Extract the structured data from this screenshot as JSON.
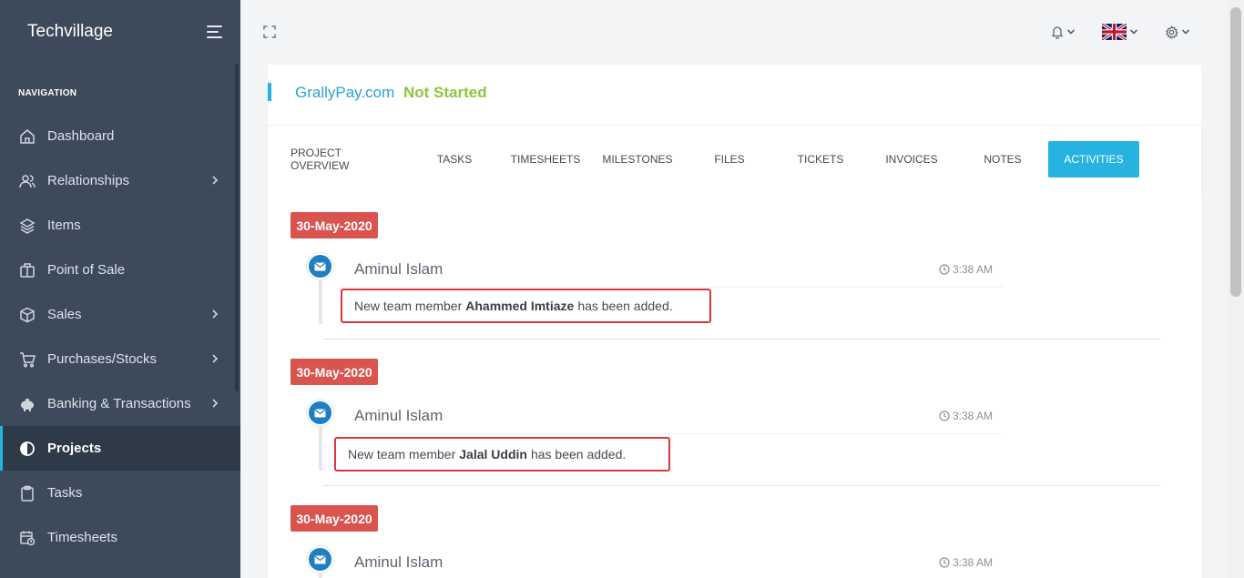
{
  "app": {
    "brand": "Techvillage"
  },
  "sidebar": {
    "heading": "NAVIGATION",
    "items": [
      {
        "label": "Dashboard",
        "icon": "home-icon",
        "has_children": false,
        "active": false
      },
      {
        "label": "Relationships",
        "icon": "users-icon",
        "has_children": true,
        "active": false
      },
      {
        "label": "Items",
        "icon": "layers-icon",
        "has_children": false,
        "active": false
      },
      {
        "label": "Point of Sale",
        "icon": "briefcase-icon",
        "has_children": false,
        "active": false
      },
      {
        "label": "Sales",
        "icon": "box-icon",
        "has_children": true,
        "active": false
      },
      {
        "label": "Purchases/Stocks",
        "icon": "cart-icon",
        "has_children": true,
        "active": false
      },
      {
        "label": "Banking & Transactions",
        "icon": "piggy-bank-icon",
        "has_children": true,
        "active": false
      },
      {
        "label": "Projects",
        "icon": "half-circle-icon",
        "has_children": false,
        "active": true
      },
      {
        "label": "Tasks",
        "icon": "clipboard-icon",
        "has_children": false,
        "active": false
      },
      {
        "label": "Timesheets",
        "icon": "calendar-clock-icon",
        "has_children": false,
        "active": false
      }
    ]
  },
  "topbar": {
    "expand_icon": "fullscreen-icon",
    "notifications_icon": "bell-icon",
    "language_icon": "uk-flag-icon",
    "settings_icon": "gear-icon"
  },
  "project": {
    "name": "GrallyPay.com",
    "status": "Not Started"
  },
  "tabs": [
    {
      "label": "PROJECT OVERVIEW",
      "active": false
    },
    {
      "label": "TASKS",
      "active": false
    },
    {
      "label": "TIMESHEETS",
      "active": false
    },
    {
      "label": "MILESTONES",
      "active": false
    },
    {
      "label": "FILES",
      "active": false
    },
    {
      "label": "TICKETS",
      "active": false
    },
    {
      "label": "INVOICES",
      "active": false
    },
    {
      "label": "NOTES",
      "active": false
    },
    {
      "label": "ACTIVITIES",
      "active": true
    }
  ],
  "activities": [
    {
      "date": "30-May-2020",
      "author": "Aminul Islam",
      "time": "3:38 AM",
      "msg_before": "New team member",
      "msg_name": "Ahammed Imtiaze",
      "msg_after": "has been added."
    },
    {
      "date": "30-May-2020",
      "author": "Aminul Islam",
      "time": "3:38 AM",
      "msg_before": "New team member",
      "msg_name": "Jalal Uddin",
      "msg_after": "has been added."
    },
    {
      "date": "30-May-2020",
      "author": "Aminul Islam",
      "time": "3:38 AM"
    }
  ],
  "colors": {
    "sidebar_bg": "#3c4a5c",
    "accent": "#27b3e0",
    "status_green": "#8cc63f",
    "date_badge": "#d9534f",
    "highlight_border": "#d9363e"
  }
}
